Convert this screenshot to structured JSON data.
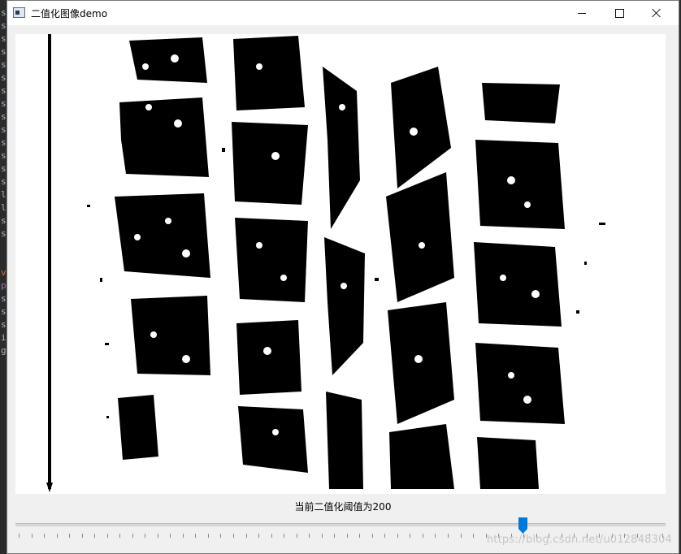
{
  "background_editor": {
    "chars": [
      "s",
      "s",
      "s",
      "s",
      "s",
      "s",
      "s",
      "s",
      "s",
      "s",
      "s",
      "s",
      "s",
      "s",
      "l",
      "l",
      "s",
      "s",
      "",
      "",
      "v",
      "p",
      "s",
      "s",
      "s",
      "i",
      "g"
    ]
  },
  "window": {
    "title": "二值化图像demo",
    "icon": "app-window-icon",
    "controls": {
      "minimize_icon": "minimize-icon",
      "maximize_icon": "maximize-icon",
      "close_icon": "close-icon"
    }
  },
  "image": {
    "description_icon": "binarized-tire-tread-image",
    "foreground_color": "#000000",
    "background_color": "#ffffff"
  },
  "caption": "当前二值化阈值为200",
  "slider": {
    "min": 0,
    "max": 255,
    "value": 200,
    "accent_color": "#0078d7"
  },
  "watermark": "https://blog.csdn.net/u012848304"
}
